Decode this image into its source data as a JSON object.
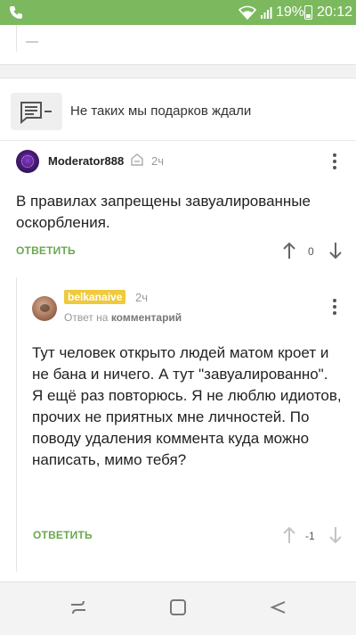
{
  "status_bar": {
    "battery_percent": "19%",
    "time": "20:12",
    "icons": [
      "phone-icon",
      "wifi-icon",
      "signal-icon",
      "battery-icon"
    ]
  },
  "post": {
    "title": "Не таких мы подарков ждали",
    "icon": "comment-collapse-icon"
  },
  "comments": [
    {
      "author": "Moderator888",
      "time": "2ч",
      "text": "В правилах запрещены завуалированные оскорбления.",
      "reply_label": "ОТВЕТИТЬ",
      "score": "0"
    },
    {
      "author": "belkanaive",
      "time": "2ч",
      "reply_to_prefix": "Ответ на",
      "reply_to_target": "комментарий",
      "text": "Тут человек открыто людей матом кроет и не бана и ничего. А тут \"завуалированно\".\nЯ ещё раз повторюсь. Я не люблю идиотов, прочих не приятных мне личностей. По поводу удаления коммента куда можно написать, мимо тебя?",
      "reply_label": "ОТВЕТИТЬ",
      "score": "-1"
    }
  ],
  "colors": {
    "status_bar": "#7cb95e",
    "accent_green": "#6aa84f",
    "author_badge": "#f0c93c"
  },
  "nav_bar": {
    "buttons": [
      "recent-apps-icon",
      "home-icon",
      "back-icon"
    ]
  }
}
